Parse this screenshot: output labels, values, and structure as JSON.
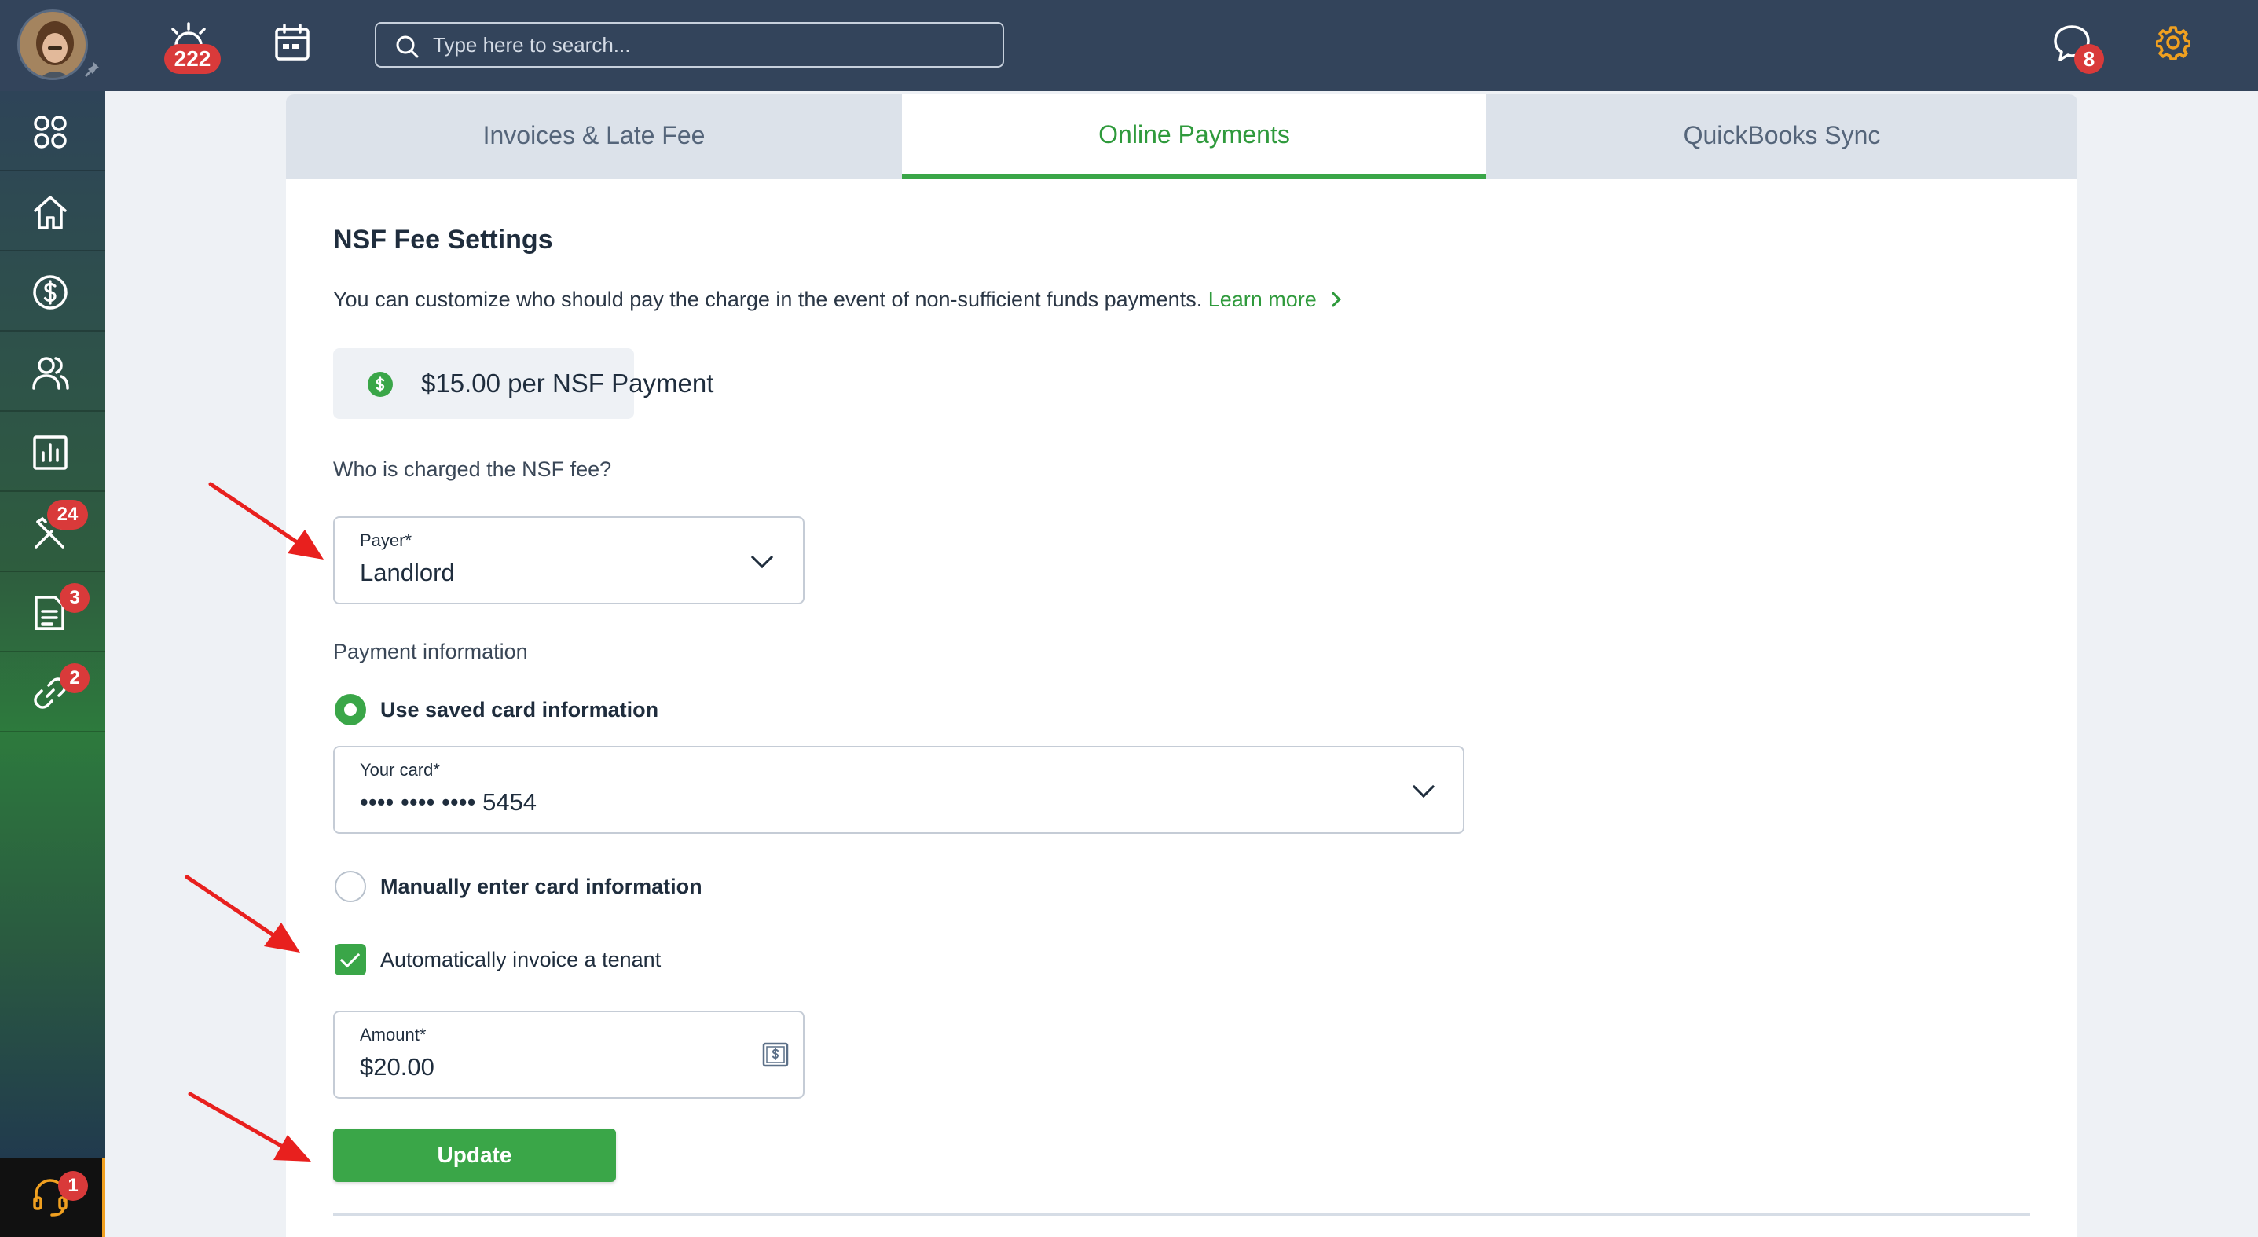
{
  "header": {
    "search_placeholder": "Type here to search...",
    "notifications_count": "222",
    "messages_count": "8"
  },
  "sidebar": {
    "items": [
      {
        "icon": "apps-grid-icon"
      },
      {
        "icon": "home-icon"
      },
      {
        "icon": "dollar-circle-icon"
      },
      {
        "icon": "people-icon"
      },
      {
        "icon": "reports-chart-icon"
      },
      {
        "icon": "tools-icon",
        "badge": "24"
      },
      {
        "icon": "document-icon",
        "badge": "3"
      },
      {
        "icon": "link-icon",
        "badge": "2"
      }
    ],
    "support_badge": "1"
  },
  "tabs": [
    {
      "label": "Invoices & Late Fee",
      "active": false
    },
    {
      "label": "Online Payments",
      "active": true
    },
    {
      "label": "QuickBooks Sync",
      "active": false
    }
  ],
  "nsf": {
    "title": "NSF Fee Settings",
    "description": "You can customize who should pay the charge in the event of non-sufficient funds payments.",
    "learn_more": "Learn more",
    "fee_text": "$15.00 per NSF Payment",
    "question": "Who is charged the NSF fee?",
    "payer_label": "Payer*",
    "payer_value": "Landlord",
    "payment_info_label": "Payment information",
    "option_saved": "Use saved card information",
    "card_label": "Your card*",
    "card_value": "•••• •••• •••• 5454",
    "option_manual": "Manually enter card information",
    "auto_invoice_label": "Automatically invoice a tenant",
    "auto_invoice_checked": true,
    "amount_label": "Amount*",
    "amount_value": "$20.00",
    "update_label": "Update"
  },
  "colors": {
    "accent": "#3aa648",
    "topbar": "#33445b",
    "badge": "#d93a3a",
    "annotation_arrow": "#e8201e"
  }
}
